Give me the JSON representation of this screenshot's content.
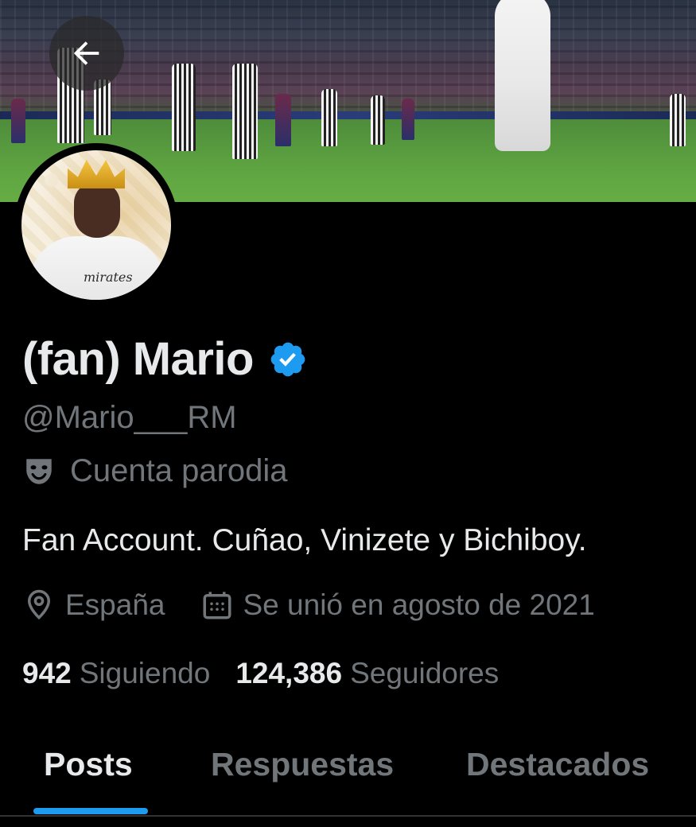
{
  "header": {
    "back_label": "Back"
  },
  "profile": {
    "display_name": "(fan) Mario",
    "verified": true,
    "handle": "@Mario___RM",
    "label": "Cuenta parodia",
    "bio": "Fan Account. Cuñao, Vinizete y Bichiboy.",
    "location": "España",
    "joined": "Se unió en agosto de 2021",
    "following_count": "942",
    "following_label": "Siguiendo",
    "followers_count": "124,386",
    "followers_label": "Seguidores",
    "avatar_shirt_text": "mirates"
  },
  "tabs": [
    {
      "label": "Posts",
      "active": true
    },
    {
      "label": "Respuestas",
      "active": false
    },
    {
      "label": "Destacados",
      "active": false
    }
  ],
  "colors": {
    "background": "#000000",
    "accent": "#1d9bf0",
    "text_primary": "#e7e9ea",
    "text_secondary": "#71767b"
  },
  "icons": {
    "back": "arrow-left-icon",
    "verified": "verified-badge-icon",
    "parody": "theater-mask-icon",
    "location": "location-pin-icon",
    "calendar": "calendar-icon"
  }
}
